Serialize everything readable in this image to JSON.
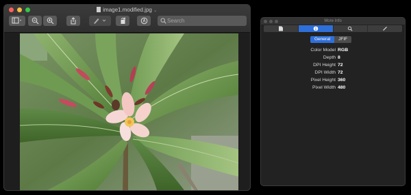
{
  "preview": {
    "title": "image1.modified.jpg",
    "search_placeholder": "Search",
    "toolbar": [
      {
        "name": "sidebar-toggle",
        "icon": "sidebar-icon"
      },
      {
        "name": "zoom-out",
        "icon": "zoom-out-icon"
      },
      {
        "name": "zoom-in",
        "icon": "zoom-in-icon"
      },
      {
        "name": "share",
        "icon": "share-icon"
      },
      {
        "name": "markup",
        "icon": "pen-icon"
      },
      {
        "name": "rotate",
        "icon": "rotate-icon"
      },
      {
        "name": "annotate",
        "icon": "annotate-icon"
      }
    ]
  },
  "info": {
    "title": "More Info",
    "tabs": [
      {
        "icon": "document-icon",
        "active": false
      },
      {
        "icon": "info-icon",
        "active": true
      },
      {
        "icon": "magnifier-icon",
        "active": false
      },
      {
        "icon": "pencil-icon",
        "active": false
      }
    ],
    "subtabs": [
      "General",
      "JFIF"
    ],
    "properties": [
      {
        "key": "Color Model",
        "value": "RGB"
      },
      {
        "key": "Depth",
        "value": "8"
      },
      {
        "key": "DPI Height",
        "value": "72"
      },
      {
        "key": "DPI Width",
        "value": "72"
      },
      {
        "key": "Pixel Height",
        "value": "360"
      },
      {
        "key": "Pixel Width",
        "value": "480"
      }
    ]
  }
}
